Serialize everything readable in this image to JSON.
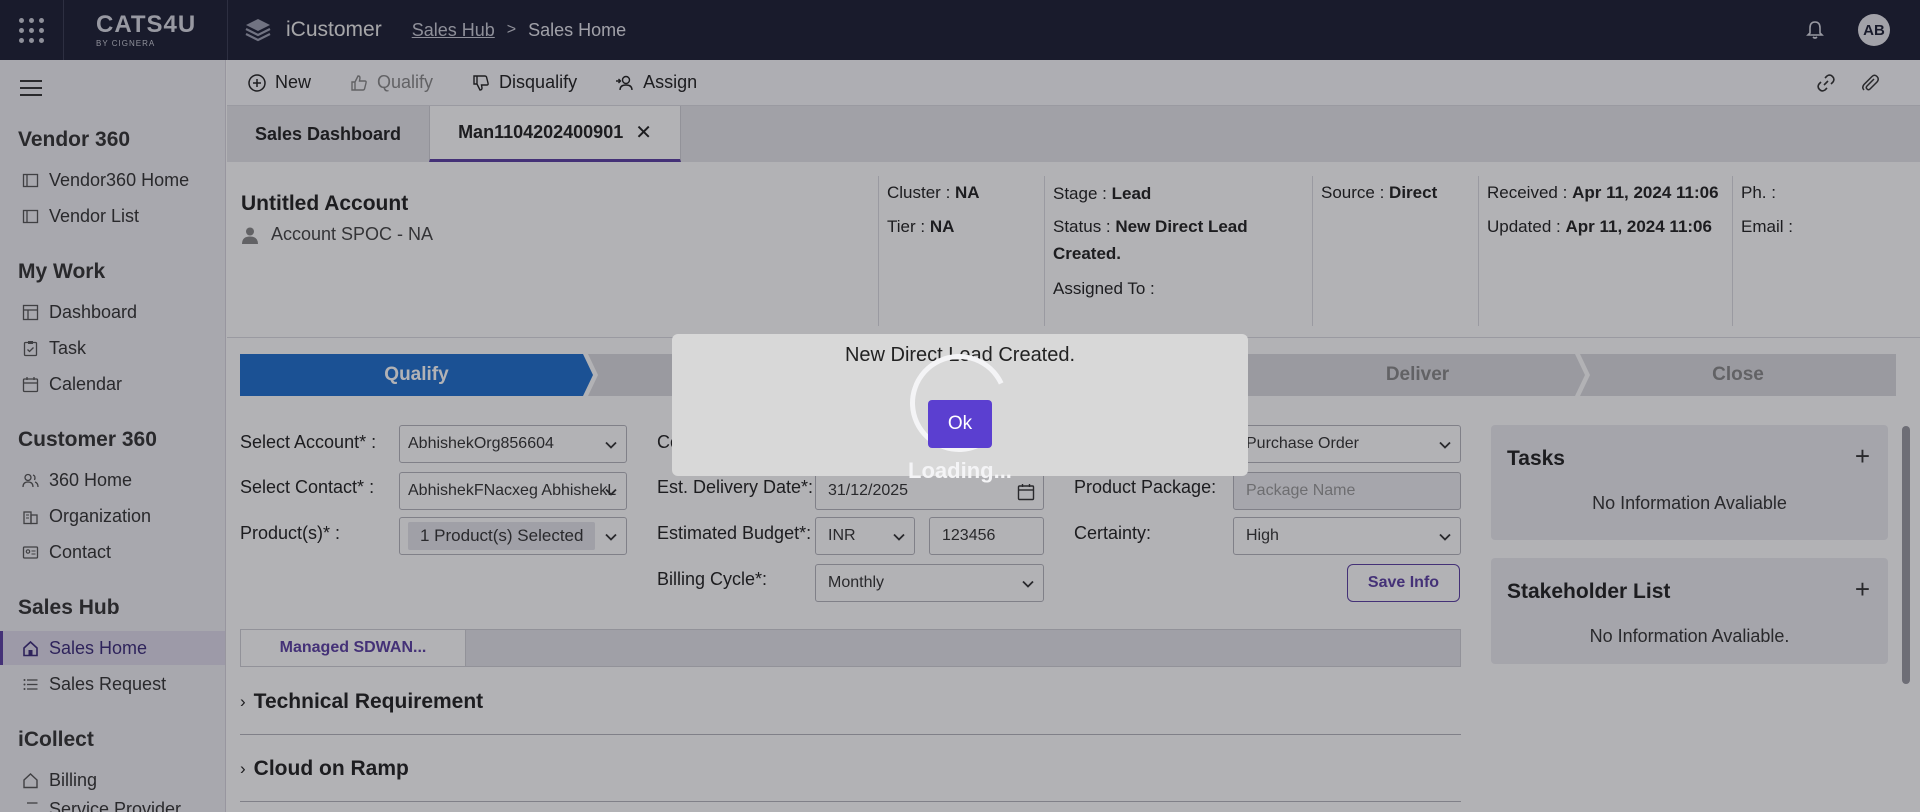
{
  "topbar": {
    "brand_main": "CATS4U",
    "brand_sub": "BY CIGNERA",
    "product_name": "iCustomer",
    "breadcrumb": [
      "Sales Hub",
      "Sales Home"
    ],
    "breadcrumb_sep": ">",
    "avatar_initials": "AB",
    "icons": [
      "apps-grid-icon",
      "layers-icon",
      "bell-icon"
    ]
  },
  "sidebar": {
    "sections": [
      {
        "title": "Vendor 360",
        "items": [
          {
            "label": "Vendor360 Home",
            "icon": "window-icon"
          },
          {
            "label": "Vendor List",
            "icon": "window-icon"
          }
        ]
      },
      {
        "title": "My Work",
        "items": [
          {
            "label": "Dashboard",
            "icon": "dashboard-icon"
          },
          {
            "label": "Task",
            "icon": "clipboard-icon"
          },
          {
            "label": "Calendar",
            "icon": "calendar-icon"
          }
        ]
      },
      {
        "title": "Customer 360",
        "items": [
          {
            "label": "360 Home",
            "icon": "users-icon"
          },
          {
            "label": "Organization",
            "icon": "building-icon"
          },
          {
            "label": "Contact",
            "icon": "contact-card-icon"
          }
        ]
      },
      {
        "title": "Sales Hub",
        "items": [
          {
            "label": "Sales Home",
            "icon": "home-icon",
            "active": true
          },
          {
            "label": "Sales Request",
            "icon": "list-icon"
          }
        ]
      },
      {
        "title": "iCollect",
        "items": [
          {
            "label": "Billing",
            "icon": "home-icon"
          },
          {
            "label": "Service Provider",
            "icon": "list-icon"
          }
        ]
      }
    ]
  },
  "actions": {
    "new": "New",
    "qualify": "Qualify",
    "disqualify": "Disqualify",
    "assign": "Assign"
  },
  "tabs": [
    {
      "label": "Sales Dashboard",
      "active": false
    },
    {
      "label": "Man1104202400901",
      "active": true,
      "closable": true
    }
  ],
  "account": {
    "title": "Untitled Account",
    "spoc": "Account SPOC - NA"
  },
  "info": {
    "cluster_label": "Cluster :",
    "cluster_value": "NA",
    "tier_label": "Tier :",
    "tier_value": "NA",
    "stage_label": "Stage :",
    "stage_value": "Lead",
    "status_label": "Status :",
    "status_value_1": "New Direct Lead",
    "status_value_2": "Created.",
    "assigned_label": "Assigned To :",
    "source_label": "Source :",
    "source_value": "Direct",
    "received_label": "Received :",
    "received_value": "Apr 11, 2024 11:06",
    "updated_label": "Updated :",
    "updated_value": "Apr 11, 2024 11:06",
    "phone_label": "Ph. :",
    "email_label": "Email :"
  },
  "stepper": {
    "steps": [
      "Qualify",
      "",
      "",
      "",
      "Deliver",
      "Close"
    ],
    "active_index": 0
  },
  "form": {
    "select_account_label": "Select Account* :",
    "select_account_value": "AbhishekOrg856604",
    "select_contact_label": "Select Contact* :",
    "select_contact_value": "AbhishekFNacxeg AbhishekL",
    "products_label": "Product(s)* :",
    "products_value": "1 Product(s) Selected",
    "col2_first_label": "Co",
    "delivery_label": "Est. Delivery Date*:",
    "delivery_value": "31/12/2025",
    "budget_label": "Estimated Budget*:",
    "budget_currency": "INR",
    "budget_amount": "123456",
    "billing_label": "Billing Cycle*:",
    "billing_value": "Monthly",
    "order_type_value": "Purchase Order",
    "package_label": "Product Package:",
    "package_placeholder": "Package Name",
    "certainty_label": "Certainty:",
    "certainty_value": "High",
    "save_button": "Save Info"
  },
  "subtabs": [
    "Managed SDWAN..."
  ],
  "accordions": [
    "Technical Requirement",
    "Cloud on Ramp"
  ],
  "panels": {
    "tasks_title": "Tasks",
    "tasks_empty": "No Information Avaliable",
    "stakeholder_title": "Stakeholder List",
    "stakeholder_empty": "No Information Avaliable.",
    "plus": "+"
  },
  "dialog": {
    "message": "New Direct Lead Created.",
    "ok": "Ok",
    "loading": "Loading..."
  }
}
